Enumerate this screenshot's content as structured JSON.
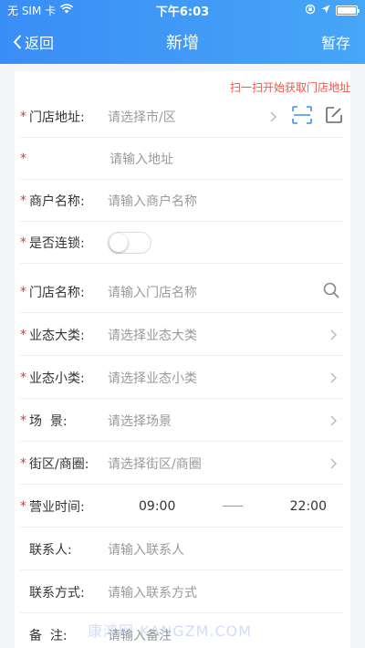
{
  "status_bar": {
    "carrier": "无 SIM 卡",
    "time": "下午6:03"
  },
  "nav": {
    "back_label": "返回",
    "title": "新增",
    "save_label": "暂存"
  },
  "scan_hint": "扫一扫开始获取门店地址",
  "form": {
    "store_address": {
      "label": "门店地址:",
      "placeholder": "请选择市/区"
    },
    "address_detail": {
      "placeholder": "请输入地址"
    },
    "merchant_name": {
      "label": "商户名称:",
      "placeholder": "请输入商户名称"
    },
    "is_chain": {
      "label": "是否连锁:",
      "toggle_on": false
    },
    "store_name": {
      "label": "门店名称:",
      "placeholder": "请输入门店名称"
    },
    "business_category": {
      "label": "业态大类:",
      "placeholder": "请选择业态大类"
    },
    "business_subcategory": {
      "label": "业态小类:",
      "placeholder": "请选择业态小类"
    },
    "scene": {
      "label": "场  景:",
      "placeholder": "请选择场景"
    },
    "district": {
      "label": "街区/商圈:",
      "placeholder": "请选择街区/商圈"
    },
    "business_hours": {
      "label": "营业时间:",
      "start": "09:00",
      "end": "22:00"
    },
    "contact_person": {
      "label": "联系人:",
      "placeholder": "请输入联系人"
    },
    "contact_method": {
      "label": "联系方式:",
      "placeholder": "请输入联系方式"
    },
    "remarks": {
      "label": "备  注:",
      "placeholder": "请输入备注"
    }
  },
  "required_mark": "*",
  "watermark": "康鸿网 KANGZM.COM",
  "colors": {
    "header_gradient_start": "#3a8df5",
    "header_gradient_end": "#46a6f7",
    "required": "#e7322d",
    "hint": "#f0584a"
  }
}
